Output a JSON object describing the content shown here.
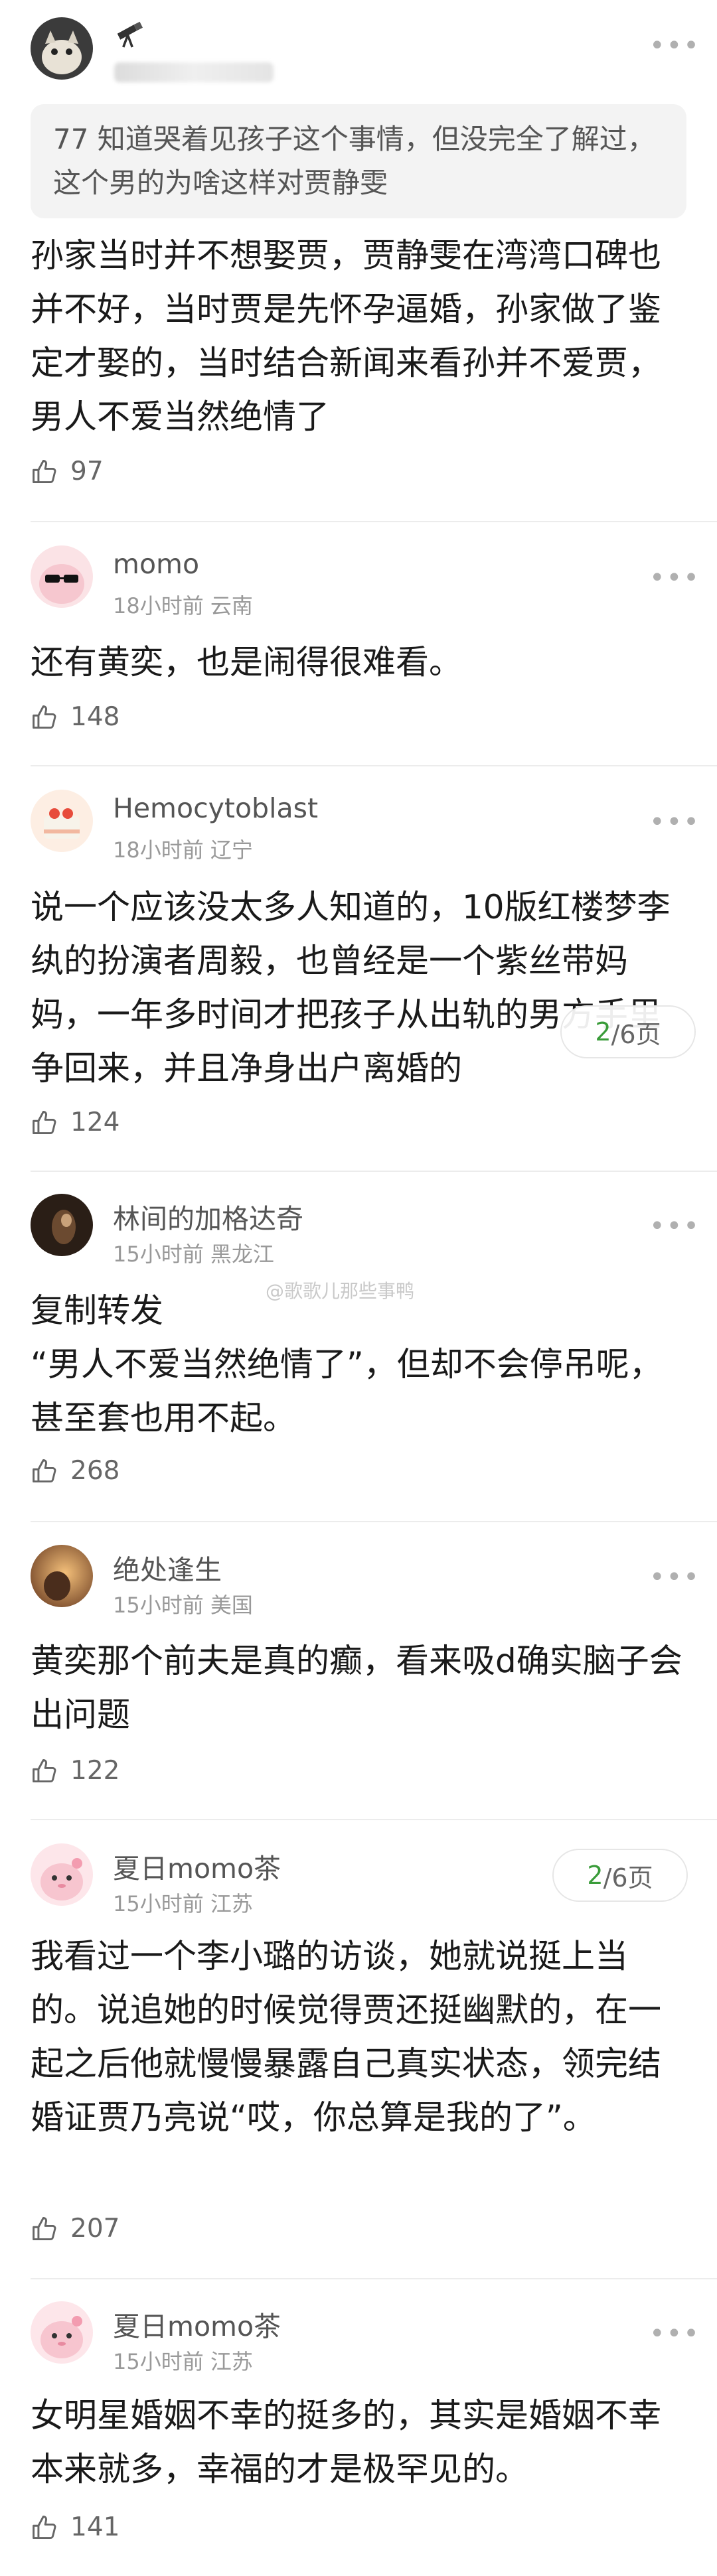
{
  "comments": [
    {
      "username": "",
      "meta": "",
      "quote": "77 知道哭着见孩子这个事情，但没完全了解过，这个男的为啥这样对贾静雯",
      "text": "孙家当时并不想娶贾，贾静雯在湾湾口碑也并不好，当时贾是先怀孕逼婚，孙家做了鉴定才娶的，当时结合新闻来看孙并不爱贾，男人不爱当然绝情了",
      "likes": "97"
    },
    {
      "username": "momo",
      "meta": "18小时前 云南",
      "text": "还有黄奕，也是闹得很难看。",
      "likes": "148"
    },
    {
      "username": "Hemocytoblast",
      "meta": "18小时前 辽宁",
      "text": "说一个应该没太多人知道的，10版红楼梦李纨的扮演者周毅，也曾经是一个紫丝带妈妈，一年多时间才把孩子从出轨的男方手里争回来，并且净身出户离婚的",
      "likes": "124"
    },
    {
      "username": "林间的加格达奇",
      "meta": "15小时前 黑龙江",
      "text": "复制转发\n“男人不爱当然绝情了”，但却不会停吊呢，甚至套也用不起。",
      "likes": "268"
    },
    {
      "username": "绝处逢生",
      "meta": "15小时前 美国",
      "text": "黄奕那个前夫是真的癫，看来吸d确实脑子会出问题",
      "likes": "122"
    },
    {
      "username": "夏日momo茶",
      "meta": "15小时前 江苏",
      "text": "我看过一个李小璐的访谈，她就说挺上当的。说追她的时候觉得贾还挺幽默的，在一起之后他就慢慢暴露自己真实状态，领完结婚证贾乃亮说“哎，你总算是我的了”。",
      "likes": "207"
    },
    {
      "username": "夏日momo茶",
      "meta": "15小时前 江苏",
      "text": "女明星婚姻不幸的挺多的，其实是婚姻不幸本来就多，幸福的才是极罕见的。",
      "likes": "141"
    }
  ],
  "pager": {
    "current": "2",
    "total": "/6页"
  },
  "watermark": "@歌歌儿那些事鸭",
  "more_glyph": "•••",
  "colors": {
    "accent_green": "#3a9c3a",
    "text": "#1a1a1a",
    "meta": "#999999"
  }
}
